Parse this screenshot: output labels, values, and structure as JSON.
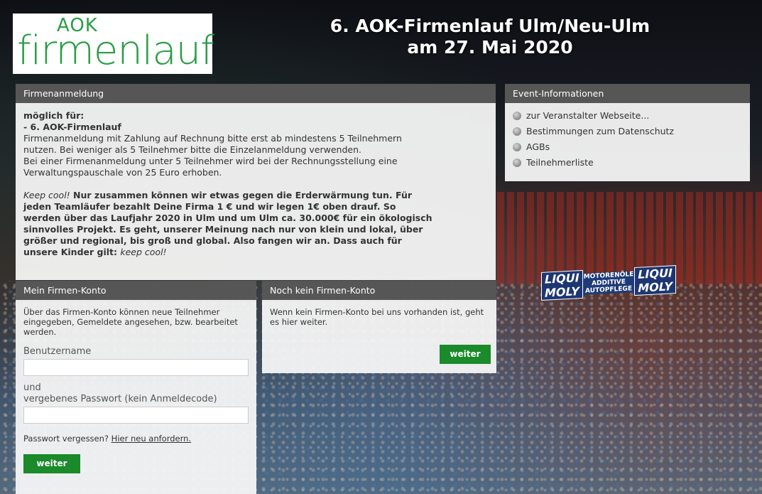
{
  "logo": {
    "top": "AOK",
    "bottom": "firmenlauf"
  },
  "header": {
    "title_line1": "6. AOK-Firmenlauf Ulm/Neu-Ulm",
    "title_line2": "am 27. Mai 2020"
  },
  "background": {
    "banner_left": "LIQUI MOLY",
    "banner_middle": "MOTORENÖLE ADDITIVE AUTOPFLEGE",
    "banner_right": "LIQUI MOLY"
  },
  "firmenanmeldung": {
    "heading": "Firmenanmeldung",
    "possible_for": "möglich für:",
    "event": "- 6. AOK-Firmenlauf",
    "p1_line1": "Firmenanmeldung mit Zahlung auf Rechnung bitte erst ab mindestens 5 Teilnehmern",
    "p1_line2": "nutzen. Bei weniger als 5 Teilnehmer bitte die Einzelanmeldung verwenden.",
    "p1_line3": "Bei einer Firmenanmeldung unter 5 Teilnehmer wird bei der Rechnungsstellung eine",
    "p1_line4": "Verwaltungspauschale von 25 Euro erhoben.",
    "keep_cool_start": "Keep cool!",
    "p2_line1": " Nur zusammen können wir etwas gegen die Erderwärmung tun. Für",
    "p2_line2": "jeden Teamläufer bezahlt Deine Firma 1 € und wir legen 1€ oben drauf. So",
    "p2_line3": "werden über das Laufjahr 2020 in Ulm und um Ulm ca. 30.000€ für ein ökologisch",
    "p2_line4": "sinnvolles Projekt. Es geht, unserer Meinung nach nur von klein und lokal, über",
    "p2_line5": "größer und regional, bis groß und global. Also fangen wir an. Dass auch für",
    "p2_line6": "unsere Kinder gilt: ",
    "keep_cool_end": "keep cool!"
  },
  "event_info": {
    "heading": "Event-Informationen",
    "items": [
      {
        "label": "zur Veranstalter Webseite..."
      },
      {
        "label": "Bestimmungen zum Datenschutz"
      },
      {
        "label": "AGBs"
      },
      {
        "label": "Teilnehmerliste"
      }
    ]
  },
  "mein_konto": {
    "heading": "Mein Firmen-Konto",
    "description": "Über das Firmen-Konto können neue Teilnehmer eingegeben, Gemeldete angesehen, bzw. bearbeitet werden.",
    "username_label": "Benutzername",
    "and_label": "und",
    "password_label": "vergebenes Passwort (kein Anmeldecode)",
    "forgot_text": "Passwort vergessen? ",
    "forgot_link": "Hier neu anfordern.",
    "button": "weiter"
  },
  "kein_konto": {
    "heading": "Noch kein Firmen-Konto",
    "description": "Wenn kein Firmen-Konto bei uns vorhanden ist, geht es hier weiter.",
    "button": "weiter"
  },
  "colors": {
    "brand_green": "#2a9d46",
    "button_green": "#1a8a2a",
    "panel_header": "#3c3c3c"
  }
}
